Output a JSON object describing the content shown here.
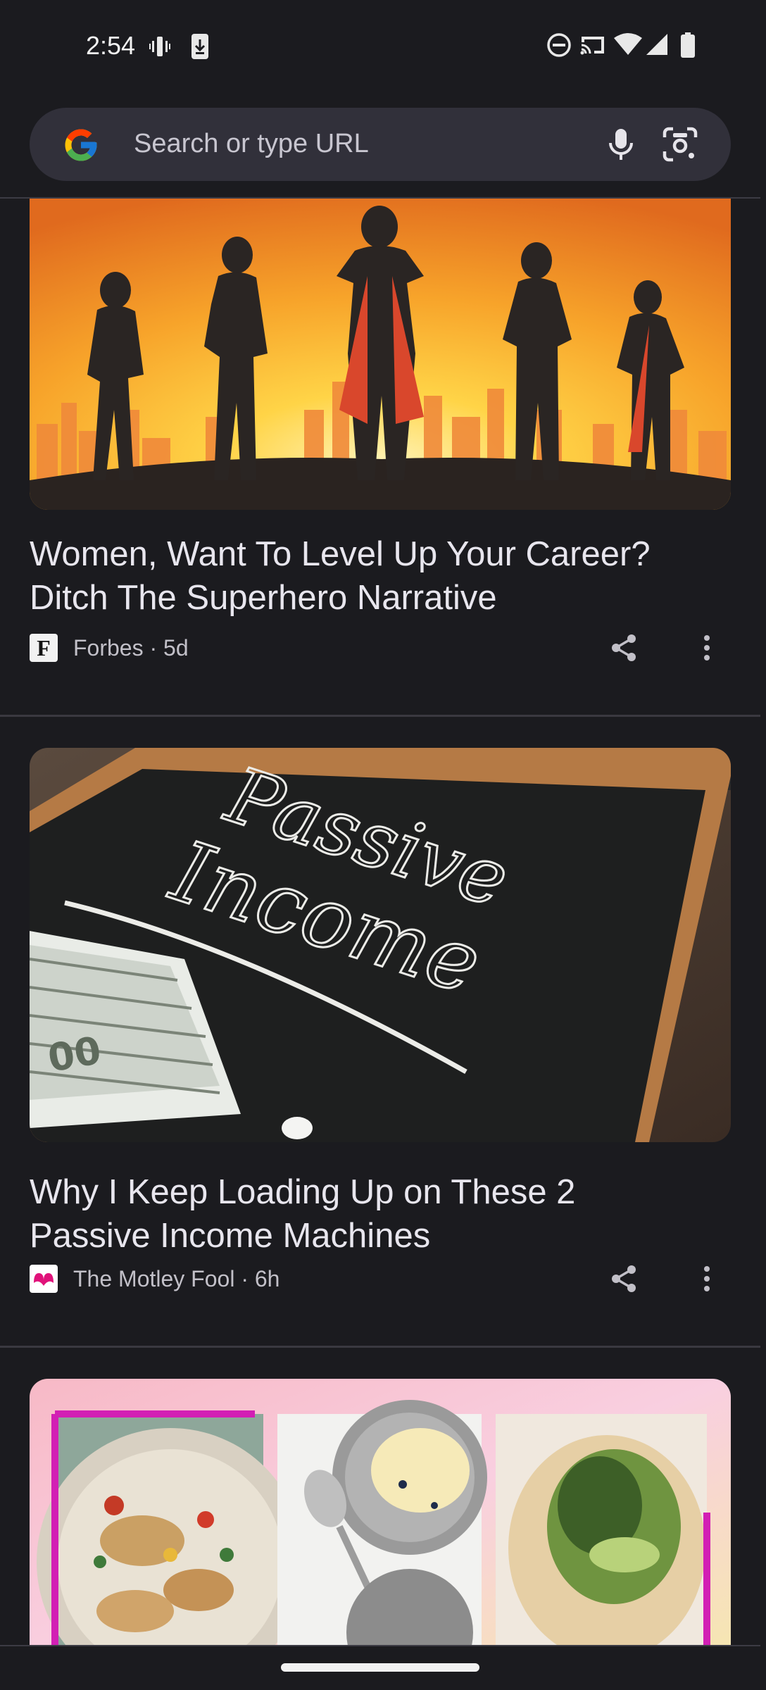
{
  "status_bar": {
    "time": "2:54",
    "left_icons": [
      "vibrate-icon",
      "download-icon"
    ],
    "right_icons": [
      "do-not-disturb-icon",
      "cast-icon",
      "wifi-icon",
      "signal-icon",
      "battery-icon"
    ]
  },
  "search": {
    "placeholder": "Search or type URL",
    "icons": [
      "google-logo-icon",
      "mic-icon",
      "lens-icon"
    ]
  },
  "feed": {
    "cards": [
      {
        "title_line1": "Women, Want To Level Up Your Career?",
        "title_line2": "Ditch The Superhero Narrative",
        "source": "Forbes · 5d",
        "source_logo_letter": "F",
        "image": "superhero-women-silhouettes-image"
      },
      {
        "title_line1": "Why I Keep Loading Up on These 2",
        "title_line2": "Passive Income Machines",
        "source": "The Motley Fool · 6h",
        "image": "passive-income-chalkboard-image",
        "image_text_line1": "Passive",
        "image_text_line2": "Income"
      },
      {
        "image": "food-collage-image"
      }
    ]
  },
  "colors": {
    "background": "#1b1b1f",
    "search_bg": "#31303a",
    "text_primary": "#e8e6ee",
    "text_secondary": "#c2c0c8"
  }
}
